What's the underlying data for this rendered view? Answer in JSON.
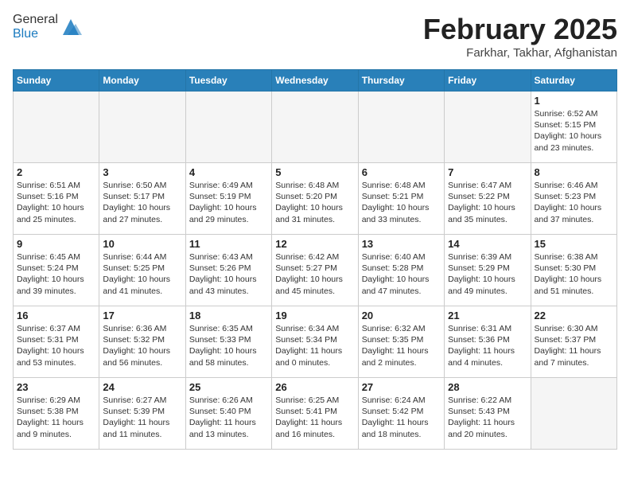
{
  "header": {
    "logo_general": "General",
    "logo_blue": "Blue",
    "month_year": "February 2025",
    "location": "Farkhar, Takhar, Afghanistan"
  },
  "days_of_week": [
    "Sunday",
    "Monday",
    "Tuesday",
    "Wednesday",
    "Thursday",
    "Friday",
    "Saturday"
  ],
  "weeks": [
    [
      {
        "day": "",
        "info": ""
      },
      {
        "day": "",
        "info": ""
      },
      {
        "day": "",
        "info": ""
      },
      {
        "day": "",
        "info": ""
      },
      {
        "day": "",
        "info": ""
      },
      {
        "day": "",
        "info": ""
      },
      {
        "day": "1",
        "info": "Sunrise: 6:52 AM\nSunset: 5:15 PM\nDaylight: 10 hours and 23 minutes."
      }
    ],
    [
      {
        "day": "2",
        "info": "Sunrise: 6:51 AM\nSunset: 5:16 PM\nDaylight: 10 hours and 25 minutes."
      },
      {
        "day": "3",
        "info": "Sunrise: 6:50 AM\nSunset: 5:17 PM\nDaylight: 10 hours and 27 minutes."
      },
      {
        "day": "4",
        "info": "Sunrise: 6:49 AM\nSunset: 5:19 PM\nDaylight: 10 hours and 29 minutes."
      },
      {
        "day": "5",
        "info": "Sunrise: 6:48 AM\nSunset: 5:20 PM\nDaylight: 10 hours and 31 minutes."
      },
      {
        "day": "6",
        "info": "Sunrise: 6:48 AM\nSunset: 5:21 PM\nDaylight: 10 hours and 33 minutes."
      },
      {
        "day": "7",
        "info": "Sunrise: 6:47 AM\nSunset: 5:22 PM\nDaylight: 10 hours and 35 minutes."
      },
      {
        "day": "8",
        "info": "Sunrise: 6:46 AM\nSunset: 5:23 PM\nDaylight: 10 hours and 37 minutes."
      }
    ],
    [
      {
        "day": "9",
        "info": "Sunrise: 6:45 AM\nSunset: 5:24 PM\nDaylight: 10 hours and 39 minutes."
      },
      {
        "day": "10",
        "info": "Sunrise: 6:44 AM\nSunset: 5:25 PM\nDaylight: 10 hours and 41 minutes."
      },
      {
        "day": "11",
        "info": "Sunrise: 6:43 AM\nSunset: 5:26 PM\nDaylight: 10 hours and 43 minutes."
      },
      {
        "day": "12",
        "info": "Sunrise: 6:42 AM\nSunset: 5:27 PM\nDaylight: 10 hours and 45 minutes."
      },
      {
        "day": "13",
        "info": "Sunrise: 6:40 AM\nSunset: 5:28 PM\nDaylight: 10 hours and 47 minutes."
      },
      {
        "day": "14",
        "info": "Sunrise: 6:39 AM\nSunset: 5:29 PM\nDaylight: 10 hours and 49 minutes."
      },
      {
        "day": "15",
        "info": "Sunrise: 6:38 AM\nSunset: 5:30 PM\nDaylight: 10 hours and 51 minutes."
      }
    ],
    [
      {
        "day": "16",
        "info": "Sunrise: 6:37 AM\nSunset: 5:31 PM\nDaylight: 10 hours and 53 minutes."
      },
      {
        "day": "17",
        "info": "Sunrise: 6:36 AM\nSunset: 5:32 PM\nDaylight: 10 hours and 56 minutes."
      },
      {
        "day": "18",
        "info": "Sunrise: 6:35 AM\nSunset: 5:33 PM\nDaylight: 10 hours and 58 minutes."
      },
      {
        "day": "19",
        "info": "Sunrise: 6:34 AM\nSunset: 5:34 PM\nDaylight: 11 hours and 0 minutes."
      },
      {
        "day": "20",
        "info": "Sunrise: 6:32 AM\nSunset: 5:35 PM\nDaylight: 11 hours and 2 minutes."
      },
      {
        "day": "21",
        "info": "Sunrise: 6:31 AM\nSunset: 5:36 PM\nDaylight: 11 hours and 4 minutes."
      },
      {
        "day": "22",
        "info": "Sunrise: 6:30 AM\nSunset: 5:37 PM\nDaylight: 11 hours and 7 minutes."
      }
    ],
    [
      {
        "day": "23",
        "info": "Sunrise: 6:29 AM\nSunset: 5:38 PM\nDaylight: 11 hours and 9 minutes."
      },
      {
        "day": "24",
        "info": "Sunrise: 6:27 AM\nSunset: 5:39 PM\nDaylight: 11 hours and 11 minutes."
      },
      {
        "day": "25",
        "info": "Sunrise: 6:26 AM\nSunset: 5:40 PM\nDaylight: 11 hours and 13 minutes."
      },
      {
        "day": "26",
        "info": "Sunrise: 6:25 AM\nSunset: 5:41 PM\nDaylight: 11 hours and 16 minutes."
      },
      {
        "day": "27",
        "info": "Sunrise: 6:24 AM\nSunset: 5:42 PM\nDaylight: 11 hours and 18 minutes."
      },
      {
        "day": "28",
        "info": "Sunrise: 6:22 AM\nSunset: 5:43 PM\nDaylight: 11 hours and 20 minutes."
      },
      {
        "day": "",
        "info": ""
      }
    ]
  ]
}
